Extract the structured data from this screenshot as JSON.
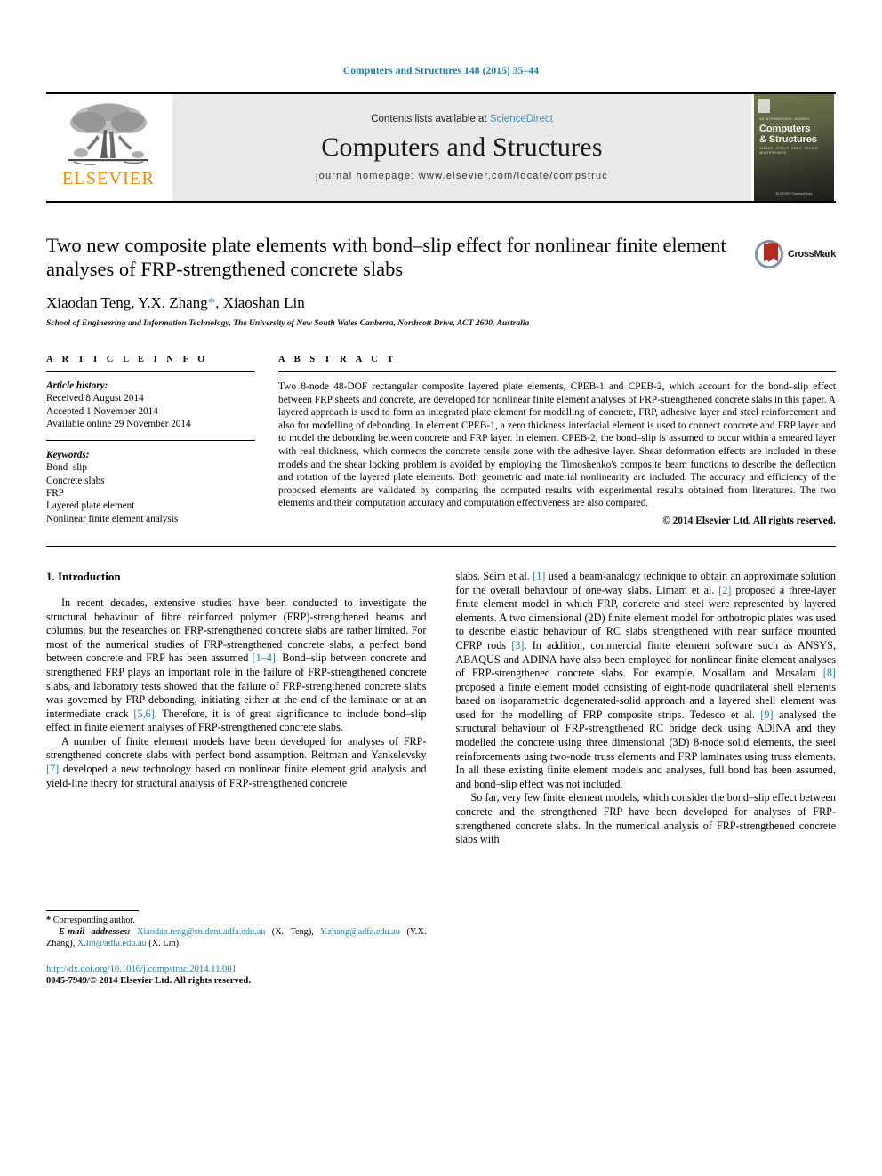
{
  "running_head": "Computers and Structures 148 (2015) 35–44",
  "masthead": {
    "publisher_word": "ELSEVIER",
    "contents_prefix": "Contents lists available at ",
    "contents_link": "ScienceDirect",
    "journal_name": "Computers and Structures",
    "homepage": "journal homepage: www.elsevier.com/locate/compstruc",
    "cover": {
      "kicker": "AN INTERNATIONAL JOURNAL",
      "title_line1": "Computers",
      "title_line2": "& Structures",
      "subtitle": "SOLIDS · STRUCTURES · FLUIDS · MULTIPHYSICS",
      "footer": "ELSEVIER\nScienceDirect"
    }
  },
  "article": {
    "title": "Two new composite plate elements with bond–slip effect for nonlinear finite element analyses of FRP-strengthened concrete slabs",
    "authors_pre": "Xiaodan Teng, Y.X. Zhang",
    "authors_star": "*",
    "authors_post": ", Xiaoshan Lin",
    "affiliation": "School of Engineering and Information Technology, The University of New South Wales Canberra, Northcott Drive, ACT 2600, Australia",
    "crossmark_label": "CrossMark"
  },
  "info": {
    "heading": "A R T I C L E   I N F O",
    "history_label": "Article history:",
    "history": [
      "Received 8 August 2014",
      "Accepted 1 November 2014",
      "Available online 29 November 2014"
    ],
    "keywords_label": "Keywords:",
    "keywords": [
      "Bond–slip",
      "Concrete slabs",
      "FRP",
      "Layered plate element",
      "Nonlinear finite element analysis"
    ]
  },
  "abstract": {
    "heading": "A B S T R A C T",
    "text": "Two 8-node 48-DOF rectangular composite layered plate elements, CPEB-1 and CPEB-2, which account for the bond–slip effect between FRP sheets and concrete, are developed for nonlinear finite element analyses of FRP-strengthened concrete slabs in this paper. A layered approach is used to form an integrated plate element for modelling of concrete, FRP, adhesive layer and steel reinforcement and also for modelling of debonding. In element CPEB-1, a zero thickness interfacial element is used to connect concrete and FRP layer and to model the debonding between concrete and FRP layer. In element CPEB-2, the bond–slip is assumed to occur within a smeared layer with real thickness, which connects the concrete tensile zone with the adhesive layer. Shear deformation effects are included in these models and the shear locking problem is avoided by employing the Timoshenko's composite beam functions to describe the deflection and rotation of the layered plate elements. Both geometric and material nonlinearity are included. The accuracy and efficiency of the proposed elements are validated by comparing the computed results with experimental results obtained from literatures. The two elements and their computation accuracy and computation effectiveness are also compared.",
    "copyright": "© 2014 Elsevier Ltd. All rights reserved."
  },
  "body": {
    "section_heading": "1. Introduction",
    "left_paragraph_1_a": "In recent decades, extensive studies have been conducted to investigate the structural behaviour of fibre reinforced polymer (FRP)-strengthened beams and columns, but the researches on FRP-strengthened concrete slabs are rather limited. For most of the numerical studies of FRP-strengthened concrete slabs, a perfect bond between concrete and FRP has been assumed ",
    "ref_1_4": "[1–4]",
    "left_paragraph_1_b": ". Bond–slip between concrete and strengthened FRP plays an important role in the failure of FRP-strengthened concrete slabs, and laboratory tests showed that the failure of FRP-strengthened concrete slabs was governed by FRP debonding, initiating either at the end of the laminate or at an intermediate crack ",
    "ref_5_6": "[5,6]",
    "left_paragraph_1_c": ". Therefore, it is of great significance to include bond–slip effect in finite element analyses of FRP-strengthened concrete slabs.",
    "left_paragraph_2_a": "A number of finite element models have been developed for analyses of FRP-strengthened concrete slabs with perfect bond assumption. Reitman and Yankelevsky ",
    "ref_7": "[7]",
    "left_paragraph_2_b": " developed a new technology based on nonlinear finite element grid analysis and yield-line theory for structural analysis of FRP-strengthened concrete",
    "right_paragraph_1_a": "slabs. Seim et al. ",
    "ref_r1": "[1]",
    "right_paragraph_1_b": " used a beam-analogy technique to obtain an approximate solution for the overall behaviour of one-way slabs. Limam et al. ",
    "ref_r2": "[2]",
    "right_paragraph_1_c": " proposed a three-layer finite element model in which FRP, concrete and steel were represented by layered elements. A two dimensional (2D) finite element model for orthotropic plates was used to describe elastic behaviour of RC slabs strengthened with near surface mounted CFRP rods ",
    "ref_r3": "[3]",
    "right_paragraph_1_d": ". In addition, commercial finite element software such as ANSYS, ABAQUS and ADINA have also been employed for nonlinear finite element analyses of FRP-strengthened concrete slabs. For example, Mosallam and Mosalam ",
    "ref_r8": "[8]",
    "right_paragraph_1_e": " proposed a finite element model consisting of eight-node quadrilateral shell elements based on isoparametric degenerated-solid approach and a layered shell element was used for the modelling of FRP composite strips. Tedesco et al. ",
    "ref_r9": "[9]",
    "right_paragraph_1_f": " analysed the structural behaviour of FRP-strengthened RC bridge deck using ADINA and they modelled the concrete using three dimensional (3D) 8-node solid elements, the steel reinforcements using two-node truss elements and FRP laminates using truss elements. In all these existing finite element models and analyses, full bond has been assumed, and bond–slip effect was not included.",
    "right_paragraph_2": "So far, very few finite element models, which consider the bond–slip effect between concrete and the strengthened FRP have been developed for analyses of FRP-strengthened concrete slabs. In the numerical analysis of FRP-strengthened concrete slabs with"
  },
  "footer": {
    "corresponding_star": "*",
    "corresponding_label": " Corresponding author.",
    "email_label": "E-mail addresses:",
    "email_1": "Xiaodan.teng@student.adfa.edu.au",
    "email_1_name": " (X. Teng), ",
    "email_2": "Y.zhang@adfa.edu.au",
    "email_2_name": " (Y.X. Zhang), ",
    "email_3": "X.lin@adfa.edu.au",
    "email_3_name": " (X. Lin).",
    "doi": "http://dx.doi.org/10.1016/j.compstruc.2014.11.001",
    "issn_line": "0045-7949/© 2014 Elsevier Ltd. All rights reserved."
  },
  "colors": {
    "link_blue": "#1f7ca8",
    "elsevier_orange": "#ED8B00",
    "band_grey": "#e9e9e9",
    "crossmark_red": "#b32b20"
  }
}
